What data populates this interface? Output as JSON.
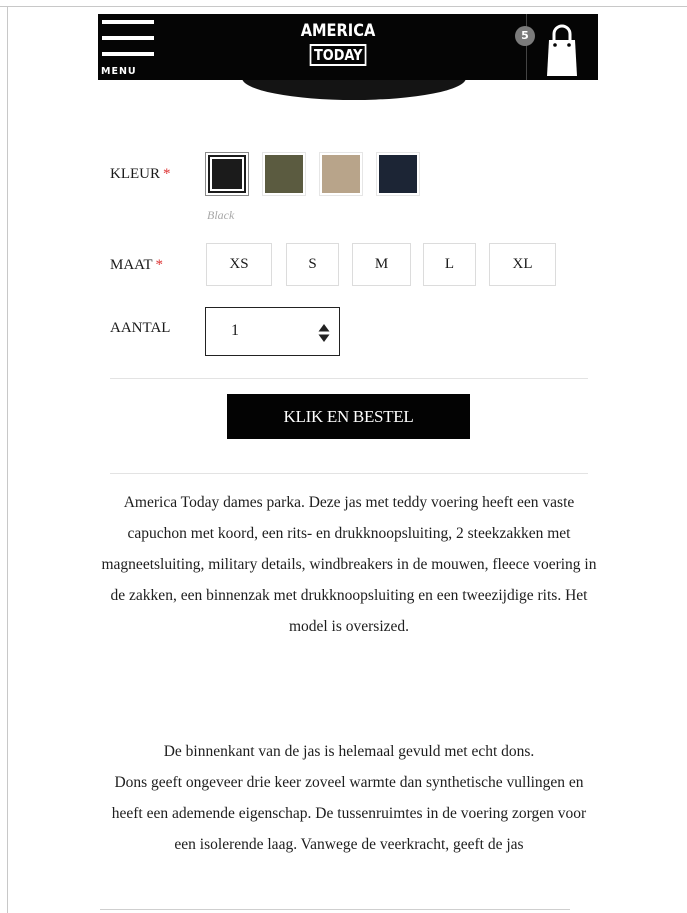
{
  "header": {
    "menu_label": "MENU",
    "logo_line1": "AMERICA",
    "logo_line2": "TODAY",
    "cart_count": "5"
  },
  "color": {
    "label": "KLEUR",
    "required_mark": "*",
    "selected_name": "Black",
    "swatches": [
      {
        "name": "Black",
        "hex": "#1b1b1b"
      },
      {
        "name": "Olive",
        "hex": "#5b5b40"
      },
      {
        "name": "Sand",
        "hex": "#b8a48a"
      },
      {
        "name": "Navy",
        "hex": "#1c2535"
      }
    ]
  },
  "size": {
    "label": "MAAT",
    "required_mark": "*",
    "options": [
      "XS",
      "S",
      "M",
      "L",
      "XL"
    ]
  },
  "quantity": {
    "label": "AANTAL",
    "value": "1"
  },
  "order_button": "KLIK EN BESTEL",
  "description": {
    "para1": "America Today dames parka. Deze jas met teddy voering heeft een vaste capuchon met koord, een rits- en drukknoopsluiting, 2 steekzakken met magneetsluiting, military details, windbreakers in de mouwen, fleece voering in de zakken, een binnenzak met drukknoopsluiting en een tweezijdige rits. Het model is oversized.",
    "para2a": "De binnenkant van de jas is helemaal gevuld met echt dons.",
    "para2b": "Dons geeft ongeveer drie keer zoveel warmte dan synthetische vullingen en heeft een ademende eigenschap. De tussenruimtes in de voering zorgen voor een isolerende laag. Vanwege de veerkracht, geeft de jas"
  }
}
